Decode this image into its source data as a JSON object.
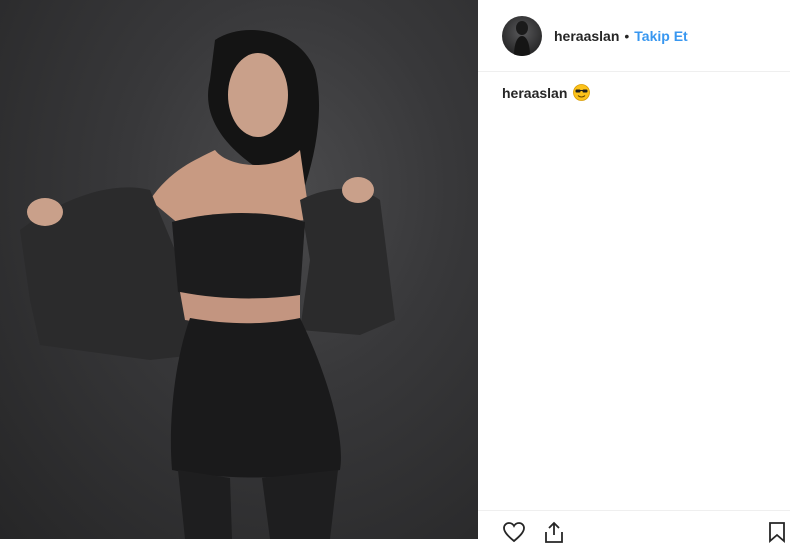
{
  "header": {
    "username": "heraaslan",
    "separator": "•",
    "follow_label": "Takip Et"
  },
  "caption": {
    "username": "heraaslan",
    "emoji": "sunglasses-emoji"
  },
  "actions": {
    "like_icon": "heart-icon",
    "share_icon": "share-icon",
    "save_icon": "bookmark-icon"
  },
  "photo": {
    "alt_subject": "woman in black outfit with leather jacket"
  },
  "colors": {
    "link": "#3897f0",
    "text": "#262626",
    "divider": "#efefef"
  }
}
